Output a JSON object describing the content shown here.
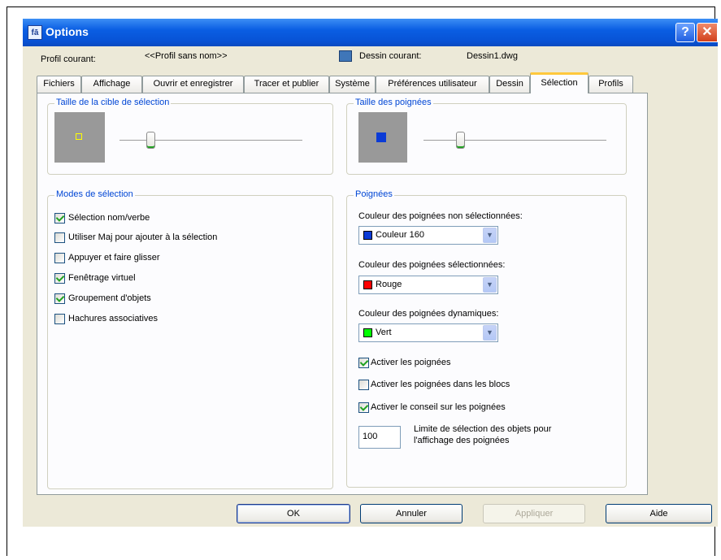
{
  "window": {
    "title": "Options",
    "icon": "options-app-icon",
    "help_label": "?",
    "close_label": "✕"
  },
  "header": {
    "profile_label": "Profil courant:",
    "profile_value": "<<Profil sans nom>>",
    "drawing_label": "Dessin courant:",
    "drawing_value": "Dessin1.dwg"
  },
  "tabs": [
    {
      "label": "Fichiers"
    },
    {
      "label": "Affichage"
    },
    {
      "label": "Ouvrir et enregistrer"
    },
    {
      "label": "Tracer et publier"
    },
    {
      "label": "Système"
    },
    {
      "label": "Préférences utilisateur"
    },
    {
      "label": "Dessin"
    },
    {
      "label": "Sélection"
    },
    {
      "label": "Profils"
    }
  ],
  "active_tab": "Sélection",
  "pickbox": {
    "title": "Taille de la cible de sélection",
    "slider_level": 0.17
  },
  "grip_size": {
    "title": "Taille des poignées",
    "slider_level": 0.2
  },
  "selection_modes": {
    "title": "Modes de sélection",
    "items": [
      {
        "label": "Sélection nom/verbe",
        "checked": true
      },
      {
        "label": "Utiliser Maj pour ajouter à la sélection",
        "checked": false
      },
      {
        "label": "Appuyer et faire glisser",
        "checked": false
      },
      {
        "label": "Fenêtrage virtuel",
        "checked": true
      },
      {
        "label": "Groupement d'objets",
        "checked": true
      },
      {
        "label": "Hachures associatives",
        "checked": false
      }
    ]
  },
  "grips": {
    "title": "Poignées",
    "unselected_label": "Couleur des poignées non sélectionnées:",
    "unselected_value": "Couleur 160",
    "unselected_color": "#0b3bd6",
    "selected_label": "Couleur des poignées sélectionnées:",
    "selected_value": "Rouge",
    "selected_color": "#ff0000",
    "dynamic_label": "Couleur des poignées dynamiques:",
    "dynamic_value": "Vert",
    "dynamic_color": "#00ff00",
    "checks": [
      {
        "label": "Activer les poignées",
        "checked": true
      },
      {
        "label": "Activer les poignées dans les blocs",
        "checked": false
      },
      {
        "label": "Activer le conseil sur les poignées",
        "checked": true
      }
    ],
    "limit_value": "100",
    "limit_label_1": "Limite de sélection des objets pour",
    "limit_label_2": "l'affichage des poignées"
  },
  "buttons": {
    "ok": "OK",
    "cancel": "Annuler",
    "apply": "Appliquer",
    "help": "Aide"
  },
  "colors": {
    "title_bar": "#0a5ee3",
    "dialog_bg": "#ece9d8",
    "group_title": "#0046d5",
    "active_tab_accent": "#ffc83c"
  }
}
